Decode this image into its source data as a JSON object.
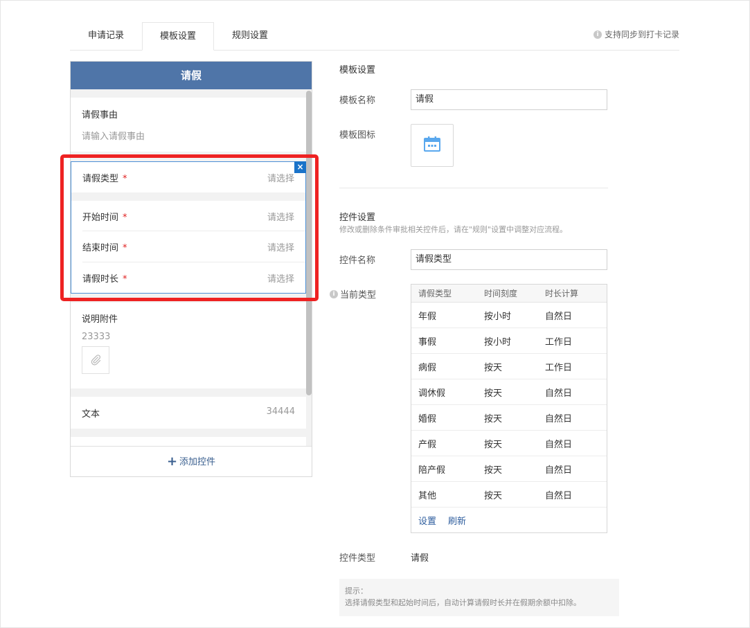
{
  "tabs": [
    {
      "label": "申请记录"
    },
    {
      "label": "模板设置"
    },
    {
      "label": "规则设置"
    }
  ],
  "sync_note": "支持同步到打卡记录",
  "preview": {
    "title": "请假",
    "reason": {
      "label": "请假事由",
      "placeholder": "请输入请假事由"
    },
    "group": [
      {
        "label": "请假类型",
        "required": "*",
        "value": "请选择"
      },
      {
        "label": "开始时间",
        "required": "*",
        "value": "请选择"
      },
      {
        "label": "结束时间",
        "required": "*",
        "value": "请选择"
      },
      {
        "label": "请假时长",
        "required": "*",
        "value": "请选择"
      }
    ],
    "attachment": {
      "label": "说明附件",
      "hint": "23333"
    },
    "text_field": {
      "label": "文本",
      "value": "34444"
    },
    "add_control": "添加控件",
    "close_glyph": "×"
  },
  "template_settings": {
    "section_title": "模板设置",
    "name_label": "模板名称",
    "name_value": "请假",
    "icon_label": "模板图标",
    "icon_name": "calendar-icon",
    "icon_color": "#5aa8ee"
  },
  "control_settings": {
    "section_title": "控件设置",
    "note": "修改或删除条件审批相关控件后，请在\"规则\"设置中调整对应流程。",
    "name_label": "控件名称",
    "name_value": "请假类型",
    "current_type_label": "当前类型",
    "table": {
      "headers": [
        "请假类型",
        "时间刻度",
        "时长计算"
      ],
      "rows": [
        [
          "年假",
          "按小时",
          "自然日"
        ],
        [
          "事假",
          "按小时",
          "工作日"
        ],
        [
          "病假",
          "按天",
          "工作日"
        ],
        [
          "调休假",
          "按天",
          "自然日"
        ],
        [
          "婚假",
          "按天",
          "自然日"
        ],
        [
          "产假",
          "按天",
          "自然日"
        ],
        [
          "陪产假",
          "按天",
          "自然日"
        ],
        [
          "其他",
          "按天",
          "自然日"
        ]
      ],
      "actions": [
        "设置",
        "刷新"
      ]
    },
    "type_label": "控件类型",
    "type_value": "请假"
  },
  "tip": {
    "title": "提示：",
    "text": "选择请假类型和起始时间后，自动计算请假时长并在假期余额中扣除。"
  },
  "colors": {
    "header_blue": "#4f75a8",
    "highlight_red": "#ee2222",
    "selected_border": "#4b8fd6",
    "link_blue": "#2f5e9e"
  }
}
